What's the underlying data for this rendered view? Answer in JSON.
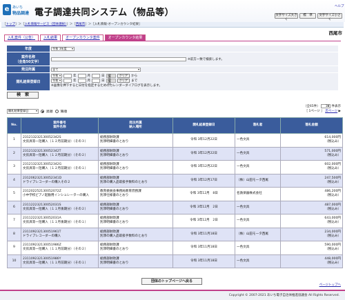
{
  "header": {
    "logo_mark": "e",
    "logo_top": "あいち",
    "logo_main": "物品調達",
    "system_title": "電子調達共同システム（物品等）",
    "btn_text_size": "文字サイズ大きく",
    "btn_standard": "標　準",
    "btn_text_small": "文字サイズ小さく",
    "link_help": "ヘルプ"
  },
  "breadcrumb": {
    "top": "トップ",
    "service": "入札情報サービス（団体選択）",
    "city": "西尾市",
    "current": "入札情報-オープンカウンタ結果"
  },
  "org_name": "西尾市",
  "tabs": [
    "入札案件（公告）",
    "入札結果",
    "オープンカウンタ案件",
    "オープンカウンタ結果"
  ],
  "form": {
    "year_label": "年度",
    "year_value": "令和 3年度",
    "name_label": "案件名称",
    "name_sub": "（全角50文字）",
    "name_hint": "※前方一致で検索します。",
    "section_label": "発注所属",
    "section_value": "全て",
    "date_label": "開札結果登録日",
    "era": "令和",
    "y": "年",
    "m": "月",
    "d": "日",
    "dow": "曜日",
    "clear": "クリア",
    "from": "から",
    "to": "まで",
    "date_hint": "※画像を押下すると日付を指定するためのカレンダーダイアログを表示します。",
    "search_btn": "検　索"
  },
  "sort": {
    "select_value": "開札結果登録日",
    "asc": "昇順",
    "desc": "降順"
  },
  "pager": {
    "count": "（全65件）",
    "per_page": "10",
    "unit": "件表示",
    "page": "［ 1ページ ］",
    "next": "次ページ"
  },
  "table": {
    "headers": {
      "no": "No.",
      "id": "案件番号",
      "name": "案件名称",
      "section": "発注所属",
      "section2": "納入場所",
      "date": "開札結果登録日",
      "winner": "落札者",
      "amount": "落札金額"
    },
    "rows": [
      {
        "no": "1",
        "id": "231213232130052342S",
        "name": "文房具等一括購入（１２月前期分）（その３）",
        "section": "総務部財政課",
        "place": "別添明細書のとおり",
        "date": "令和 3年12月22日",
        "winner": "一色文具",
        "amount": "614,000円",
        "tax": "（税込み）"
      },
      {
        "no": "2",
        "id": "231213232130052342T",
        "name": "文房具等一括購入（１２月前期分）（その２）",
        "section": "総務部財政課",
        "place": "別添明細書のとおり",
        "date": "令和 3年12月22日",
        "winner": "一色文具",
        "amount": "571,000円",
        "tax": "（税込み）"
      },
      {
        "no": "3",
        "id": "231213232130052342G",
        "name": "文房具等一括購入（１２月前期分）（その１）",
        "section": "総務部財政課",
        "place": "別添明細書のとおり",
        "date": "令和 3年12月22日",
        "winner": "一色文具",
        "amount": "602,000円",
        "tax": "（税込み）"
      },
      {
        "no": "4",
        "id": "231206232130052341D",
        "name": "ドライブレコーダーの購入その２",
        "section": "総務部財政課",
        "place": "別添の購入品取扱手数料のとおり",
        "date": "令和 3年12月17日",
        "winner": "（株）山田モータ西尾",
        "amount": "247,500円",
        "tax": "（税込み）"
      },
      {
        "no": "5",
        "id": "231202252130052072Z",
        "name": "小中学校ピアノ起動用インシュレーターの購入",
        "section": "教育委員会事務局教育庶務課",
        "place": "別添仕様書のとおり",
        "date": "令和 3年12月　8日",
        "winner": "名鉄楽器株式会社",
        "amount": "486,200円",
        "tax": "（税込み）"
      },
      {
        "no": "6",
        "id": "231122232130052031S",
        "name": "文房具等一括購入（１１月後期分）（その２）",
        "section": "総務部財政課",
        "place": "別添明細書のとおり",
        "date": "令和 3年12月　2日",
        "winner": "一色文具",
        "amount": "487,000円",
        "tax": "（税込み）"
      },
      {
        "no": "7",
        "id": "231122232130052031A",
        "name": "文房具等一括購入（１１月後期分）（その１）",
        "section": "総務部財政課",
        "place": "別添明細書のとおり",
        "date": "令和 3年12月　2日",
        "winner": "一色文具",
        "amount": "643,000円",
        "tax": "（税込み）"
      },
      {
        "no": "8",
        "id": "231109232130051961T",
        "name": "ドライブレコーダーの購入",
        "section": "総務部財政課",
        "place": "別添の購入品取扱手数料のとおり",
        "date": "令和 3年11月18日",
        "winner": "（株）山田モータ西尾",
        "amount": "234,000円",
        "tax": "（税込み）"
      },
      {
        "no": "9",
        "id": "231109232130051986Z",
        "name": "文房具等一括購入（１１月前期分）（その２）",
        "section": "総務部財政課",
        "place": "別添明細書のとおり",
        "date": "令和 3年11月18日",
        "winner": "一色文具",
        "amount": "590,000円",
        "tax": "（税込み）"
      },
      {
        "no": "10",
        "id": "231109232130051986Y",
        "name": "文房具等一括購入（１１月前期分）（その１）",
        "section": "総務部財政課",
        "place": "別添明細書のとおり",
        "date": "令和 3年11月18日",
        "winner": "一色文具",
        "amount": "448,000円",
        "tax": "（税込み）"
      }
    ]
  },
  "buttons": {
    "back_top": "団体のトップページへ戻る",
    "page_top": "ページトップへ"
  },
  "footer": {
    "copyright": "Copyright © 2007-2021 あいち電子自治体推進協議会 All Rights Reserved."
  },
  "colors": {
    "nav_blue": "#3a5c9c",
    "accent_pink": "#c0408a",
    "row_alt": "#dfe3f6"
  }
}
